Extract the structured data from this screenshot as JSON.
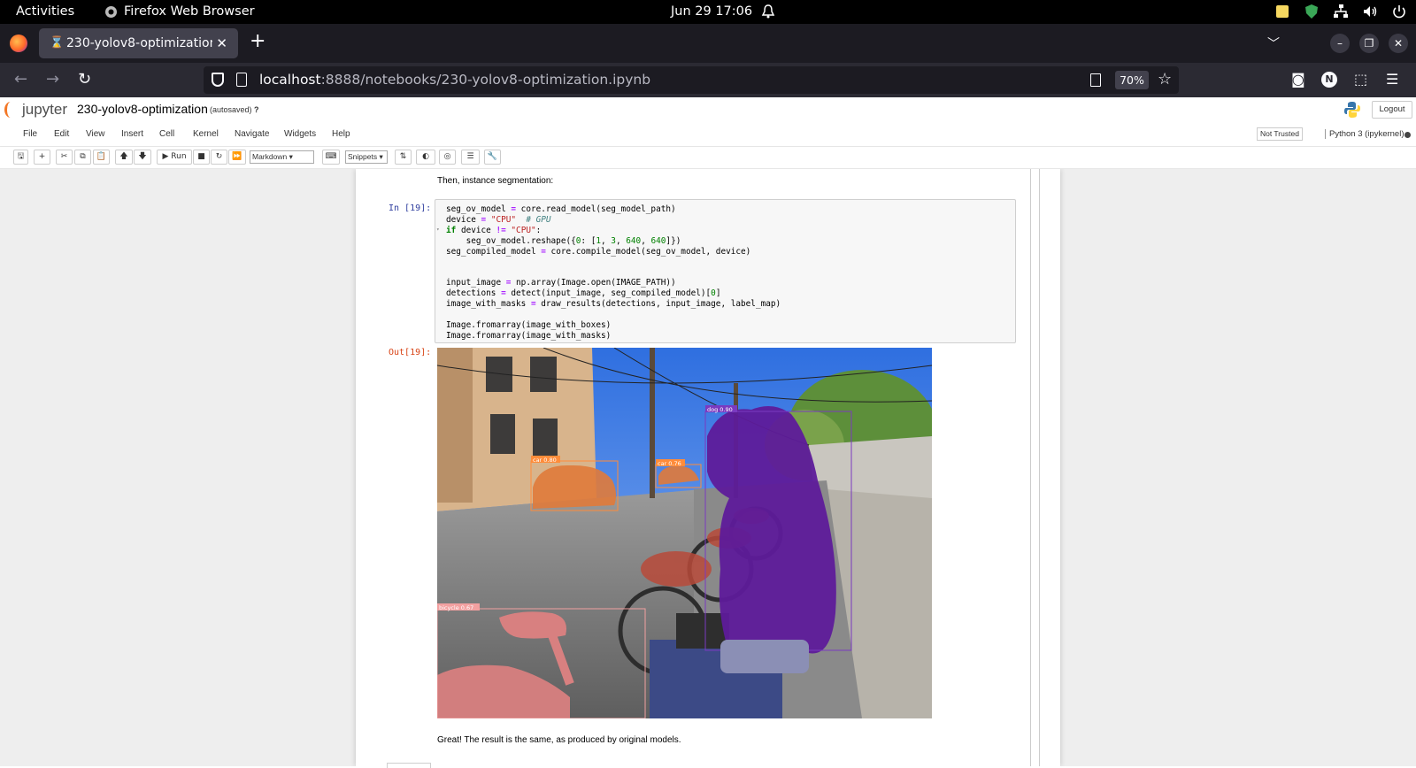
{
  "system": {
    "activities": "Activities",
    "app_name": "Firefox Web Browser",
    "clock": "Jun 29  17:06"
  },
  "browser": {
    "tab_title": "230-yolov8-optimization",
    "url_host": "localhost",
    "url_rest": ":8888/notebooks/230-yolov8-optimization.ipynb",
    "zoom": "70%",
    "profile_initial": "N"
  },
  "jupyter": {
    "logo_text": "jupyter",
    "notebook_name": "230-yolov8-optimization",
    "autosave": "(autosaved)",
    "help_mark": "?",
    "logout": "Logout",
    "menu": [
      "File",
      "Edit",
      "View",
      "Insert",
      "Cell",
      "Kernel",
      "Navigate",
      "Widgets",
      "Help"
    ],
    "trusted": "Not Trusted",
    "kernel": "Python 3 (ipykernel)",
    "toolbar": {
      "run": "Run",
      "cell_type": "Markdown",
      "snippets": "Snippets"
    }
  },
  "notebook": {
    "md_before": "Then, instance segmentation:",
    "in_prompt": "In [19]:",
    "out_prompt": "Out[19]:",
    "md_after": "Great! The result is the same, as produced by original models.",
    "image_labels": {
      "dog": "dog 0.90",
      "car1": "car 0.80",
      "car2": "car 0.76",
      "bicycle": "bicycle 0.67"
    }
  }
}
